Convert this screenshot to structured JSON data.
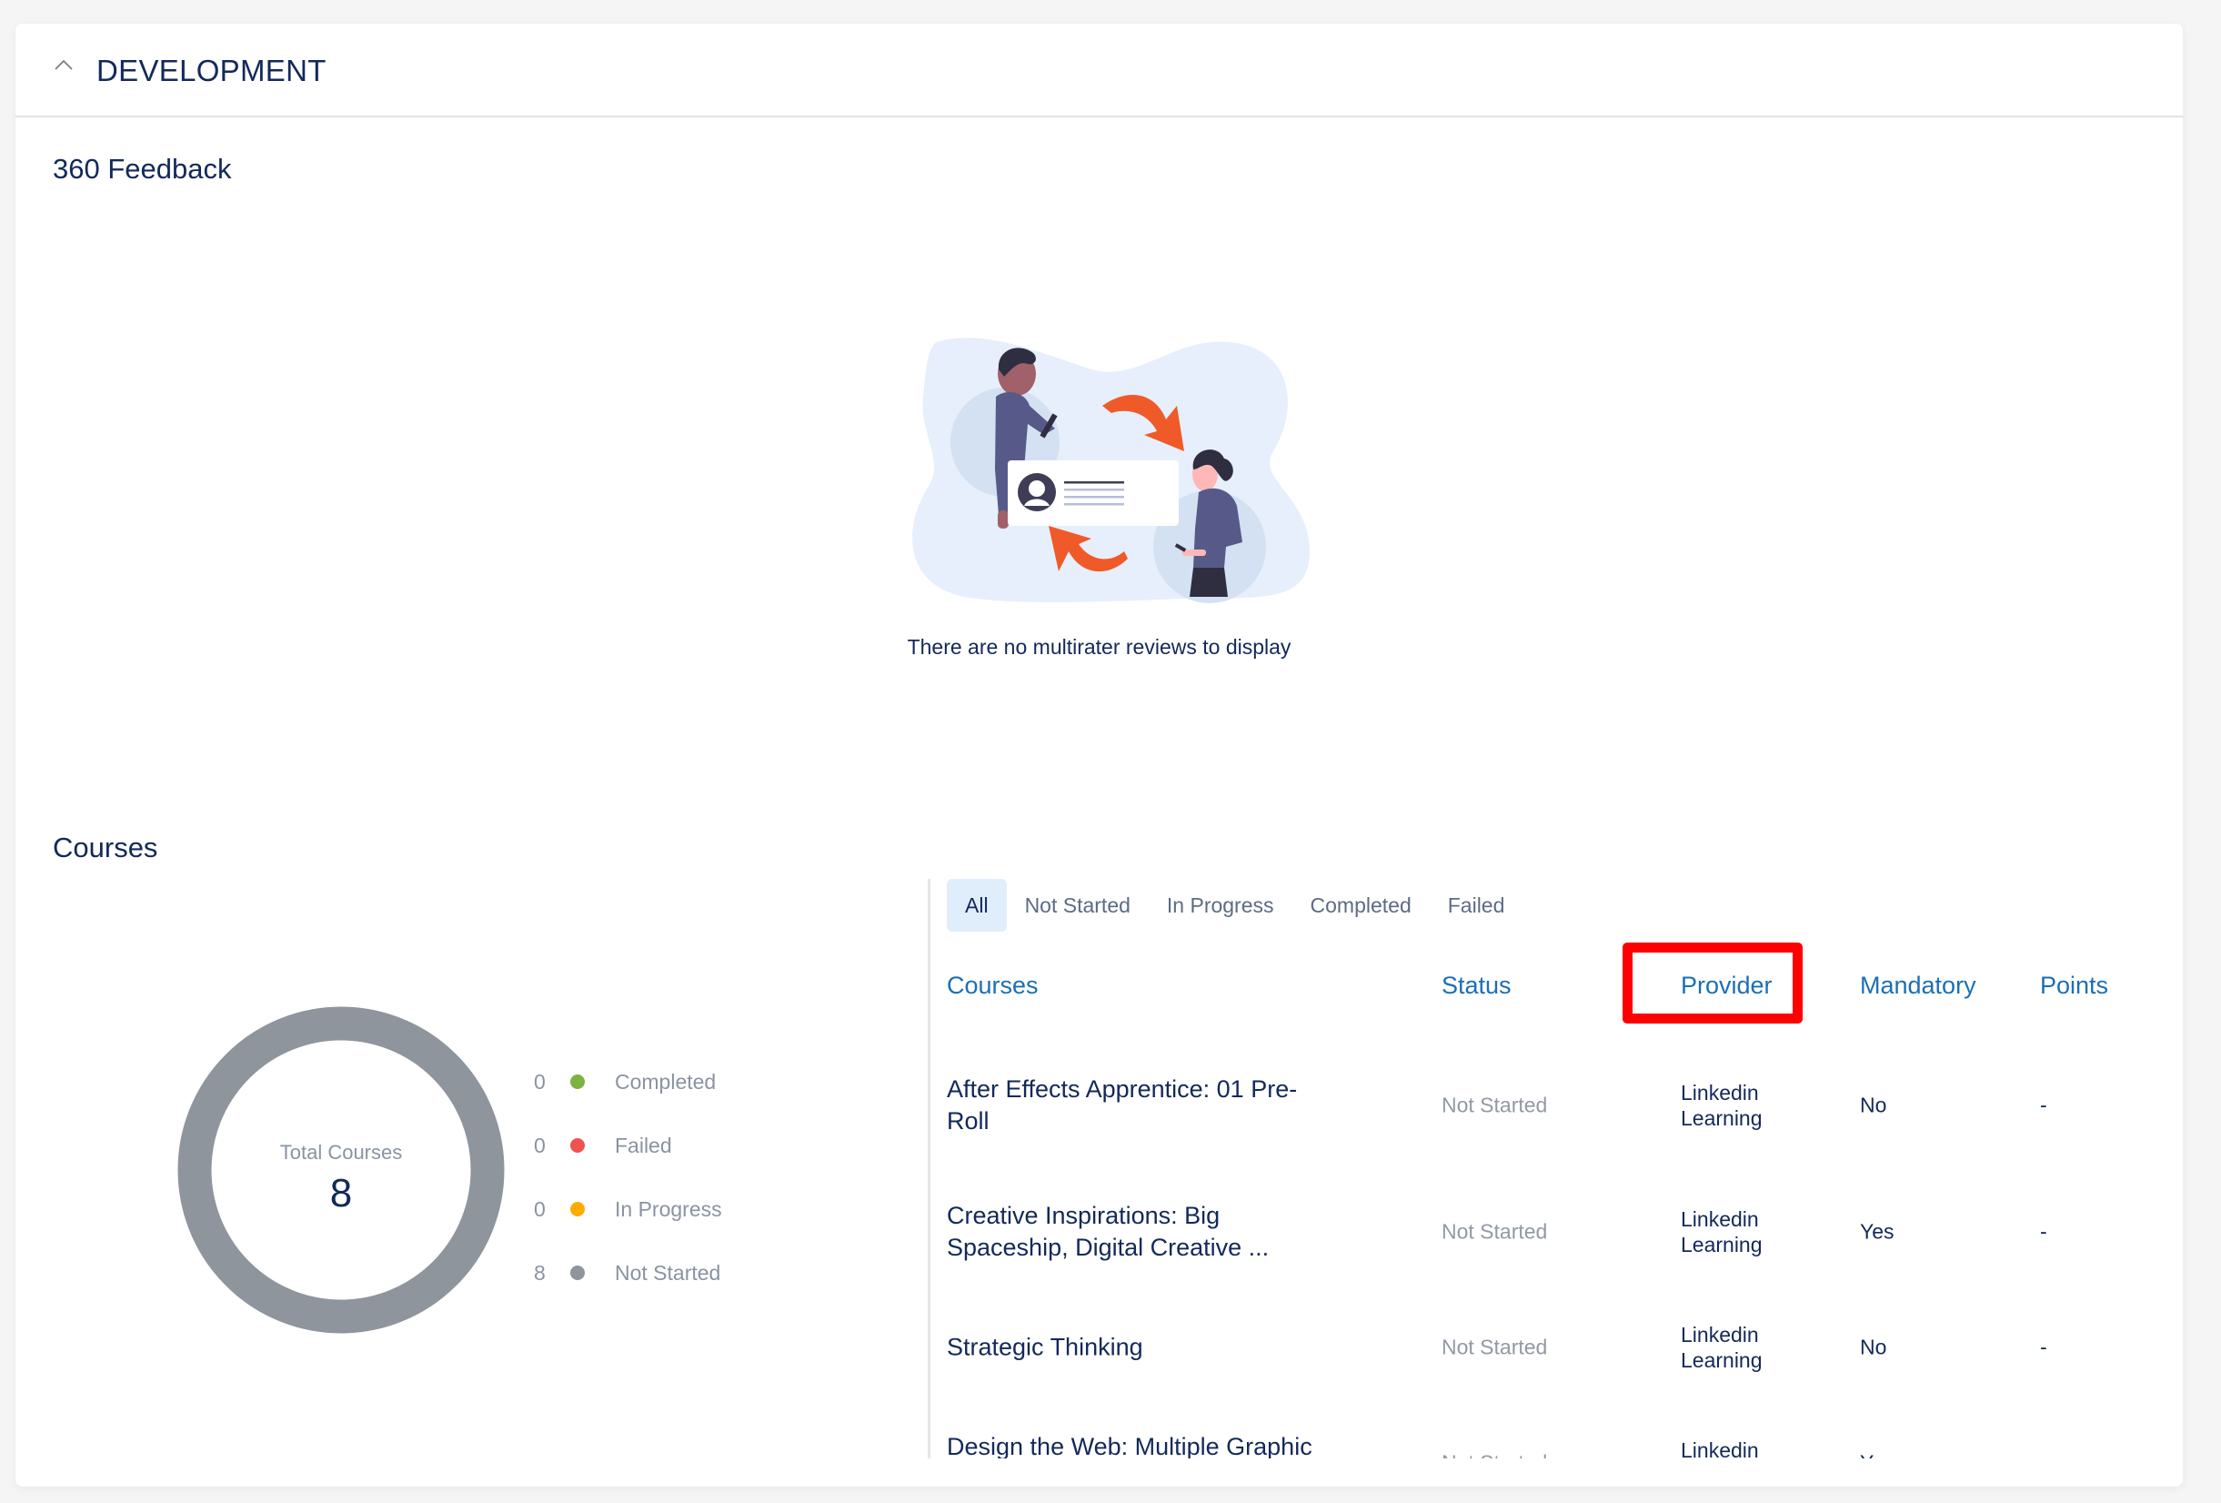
{
  "header": {
    "title": "DEVELOPMENT",
    "collapse_icon": "chevron-up-icon"
  },
  "feedback": {
    "title": "360 Feedback",
    "illustration": "multirater-review-illustration",
    "empty_message": "There are no multirater reviews to display"
  },
  "courses": {
    "title": "Courses",
    "summary": {
      "center_label": "Total Courses",
      "total": "8"
    },
    "legend": [
      {
        "count": "0",
        "label": "Completed",
        "color": "#7cb342"
      },
      {
        "count": "0",
        "label": "Failed",
        "color": "#ef5350"
      },
      {
        "count": "0",
        "label": "In Progress",
        "color": "#ffab00"
      },
      {
        "count": "8",
        "label": "Not Started",
        "color": "#8e959c"
      }
    ],
    "tabs": [
      {
        "label": "All",
        "active": true
      },
      {
        "label": "Not Started",
        "active": false
      },
      {
        "label": "In Progress",
        "active": false
      },
      {
        "label": "Completed",
        "active": false
      },
      {
        "label": "Failed",
        "active": false
      }
    ],
    "columns": {
      "course": "Courses",
      "status": "Status",
      "provider": "Provider",
      "mandatory": "Mandatory",
      "points": "Points"
    },
    "rows": [
      {
        "course": "After Effects Apprentice: 01 Pre-Roll",
        "status": "Not Started",
        "provider": "Linkedin Learning",
        "mandatory": "No",
        "points": "-"
      },
      {
        "course": "Creative Inspirations: Big Spaceship, Digital Creative ...",
        "status": "Not Started",
        "provider": "Linkedin Learning",
        "mandatory": "Yes",
        "points": "-"
      },
      {
        "course": "Strategic Thinking",
        "status": "Not Started",
        "provider": "Linkedin Learning",
        "mandatory": "No",
        "points": "-"
      },
      {
        "course": "Design the Web: Multiple Graphic Sizes",
        "status": "Not Started",
        "provider": "Linkedin Learning",
        "mandatory": "Yes",
        "points": "-"
      }
    ],
    "highlighted_column": "Provider"
  },
  "colors": {
    "primary_text": "#13295a",
    "link_blue": "#1b6fb5",
    "highlight_red": "#ff0000",
    "active_tab_bg": "#e0eefb",
    "accent_orange": "#f05a28"
  },
  "chart_data": {
    "type": "pie",
    "title": "Total Courses",
    "categories": [
      "Completed",
      "Failed",
      "In Progress",
      "Not Started"
    ],
    "values": [
      0,
      0,
      0,
      8
    ],
    "colors": [
      "#7cb342",
      "#ef5350",
      "#ffab00",
      "#8e959c"
    ],
    "center_value": 8,
    "donut": true,
    "legend": "right"
  }
}
